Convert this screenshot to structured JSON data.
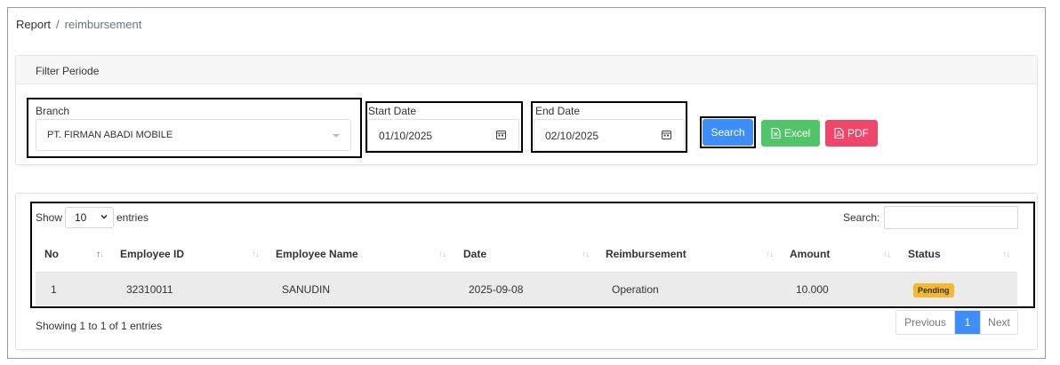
{
  "breadcrumb": {
    "root": "Report",
    "separator": "/",
    "current": "reimbursement"
  },
  "filter": {
    "header": "Filter Periode",
    "branch_label": "Branch",
    "branch_value": "PT. FIRMAN ABADI MOBILE",
    "start_label": "Start Date",
    "start_value": "01/10/2025",
    "end_label": "End Date",
    "end_value": "02/10/2025",
    "search_button": "Search",
    "excel_button": "Excel",
    "pdf_button": "PDF"
  },
  "table": {
    "show_label": "Show",
    "entries_label": "entries",
    "page_length": "10",
    "search_label": "Search:",
    "search_value": "",
    "columns": [
      "No",
      "Employee ID",
      "Employee Name",
      "Date",
      "Reimbursement",
      "Amount",
      "Status"
    ],
    "rows": [
      {
        "no": "1",
        "employee_id": "32310011",
        "employee_name": "SANUDIN",
        "date": "2025-09-08",
        "reimbursement": "Operation",
        "amount": "10.000",
        "status": "Pending"
      }
    ],
    "info": "Showing 1 to 1 of 1 entries",
    "pagination": {
      "previous": "Previous",
      "current": "1",
      "next": "Next"
    }
  },
  "colors": {
    "primary": "#3d8ef8",
    "success": "#52c46a",
    "danger": "#f0466b",
    "warning": "#f5b82e"
  }
}
